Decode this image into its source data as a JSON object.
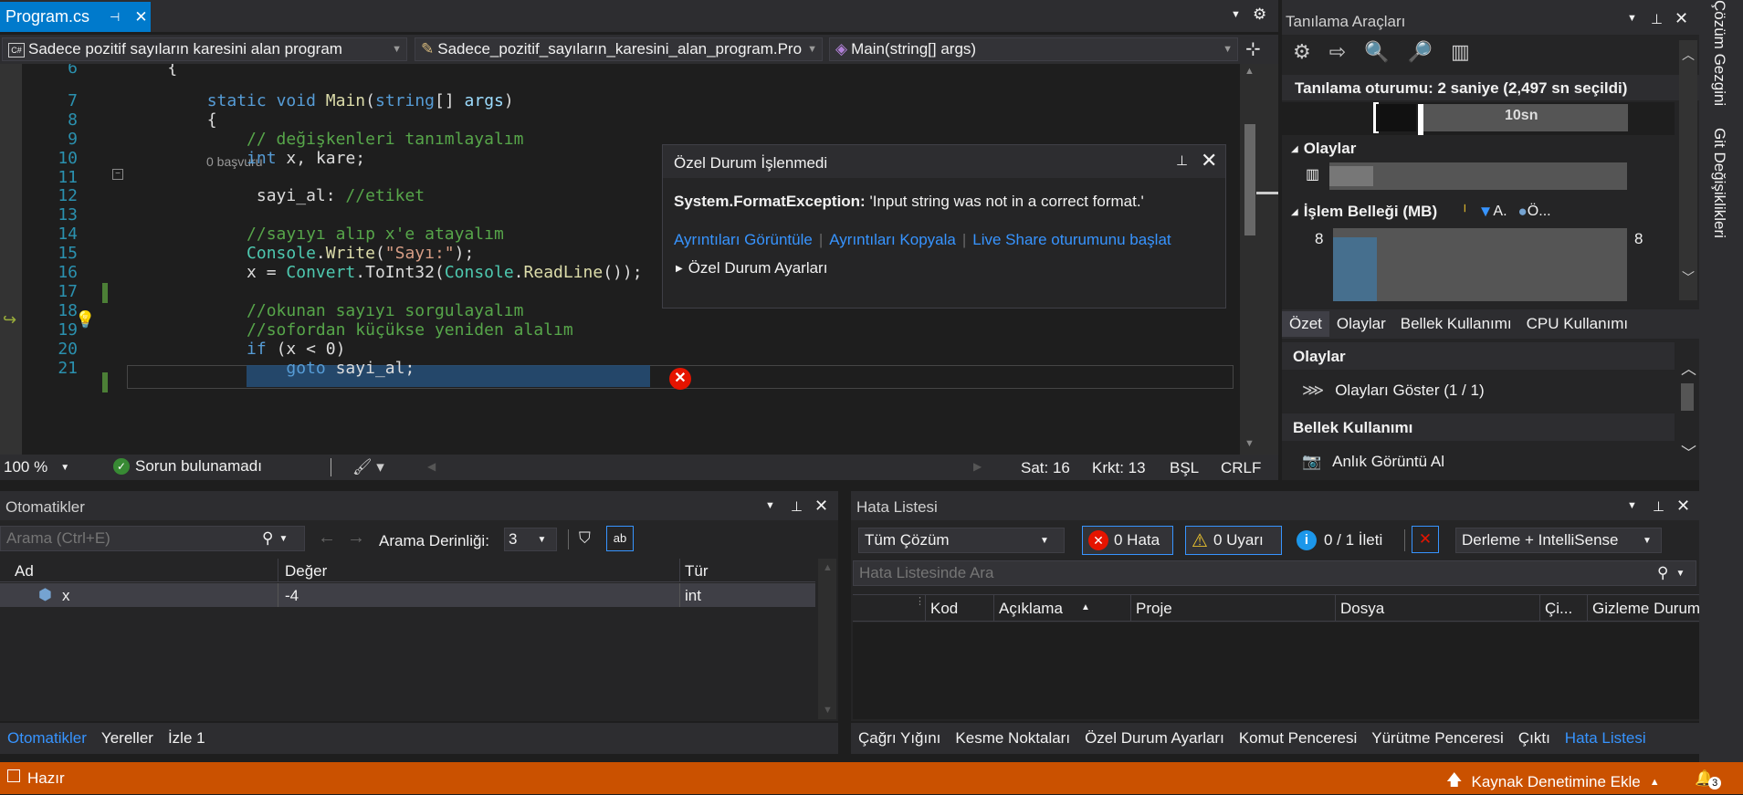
{
  "editor": {
    "tab_title": "Program.cs",
    "nav_project": "Sadece pozitif sayıların karesini alan program",
    "nav_class": "Sadece_pozitif_sayıların_karesini_alan_program.Pro",
    "nav_member": "Main(string[] args)",
    "references": "0 başvuru",
    "lines": [
      {
        "n": "6",
        "code": "    {"
      },
      {
        "n": "7",
        "code": "        static void Main(string[] args)"
      },
      {
        "n": "8",
        "code": "        {"
      },
      {
        "n": "9",
        "code": "            // değişkenleri tanımlayalım"
      },
      {
        "n": "10",
        "code": "            int x, kare;"
      },
      {
        "n": "11",
        "code": ""
      },
      {
        "n": "12",
        "code": "             sayi_al: //etiket"
      },
      {
        "n": "13",
        "code": ""
      },
      {
        "n": "14",
        "code": "            //sayıyı alıp x'e atayalım"
      },
      {
        "n": "15",
        "code": "            Console.Write(\"Sayı:\");"
      },
      {
        "n": "16",
        "code": "            x = Convert.ToInt32(Console.ReadLine());"
      },
      {
        "n": "17",
        "code": ""
      },
      {
        "n": "18",
        "code": "            //okunan sayıyı sorgulayalım"
      },
      {
        "n": "19",
        "code": "            //sofordan küçükse yeniden alalım"
      },
      {
        "n": "20",
        "code": "            if (x < 0)"
      },
      {
        "n": "21",
        "code": "                goto sayi_al;"
      }
    ],
    "zoom": "100 %",
    "issues": "Sorun bulunamadı",
    "line_pos": "Sat: 16",
    "col_pos": "Krkt: 13",
    "insert_mode": "BŞL",
    "line_ending": "CRLF"
  },
  "popup": {
    "title": "Özel Durum İşlenmedi",
    "exception_type": "System.FormatException:",
    "message": "'Input string was not in a correct format.'",
    "link1": "Ayrıntıları Görüntüle",
    "link2": "Ayrıntıları Kopyala",
    "link3": "Live Share oturumunu başlat",
    "settings": "Özel Durum Ayarları"
  },
  "diag": {
    "title": "Tanılama Araçları",
    "session": "Tanılama oturumu: 2 saniye (2,497 sn seçildi)",
    "timeline_label": "10sn",
    "events_label": "Olaylar",
    "memory_label": "İşlem Belleği (MB)",
    "legend_a": "A.",
    "legend_o": "Ö...",
    "mem_left": "8",
    "mem_right": "8",
    "tabs": [
      "Özet",
      "Olaylar",
      "Bellek Kullanımı",
      "CPU Kullanımı"
    ],
    "sec_events": "Olaylar",
    "show_events": "Olayları Göster (1 / 1)",
    "sec_memory": "Bellek Kullanımı",
    "snapshot": "Anlık Görüntü Al"
  },
  "autos": {
    "title": "Otomatikler",
    "search_placeholder": "Arama (Ctrl+E)",
    "depth_label": "Arama Derinliği:",
    "depth_value": "3",
    "col_name": "Ad",
    "col_value": "Değer",
    "col_type": "Tür",
    "row_name": "x",
    "row_value": "-4",
    "row_type": "int",
    "tabs": [
      "Otomatikler",
      "Yereller",
      "İzle 1"
    ]
  },
  "errors": {
    "title": "Hata Listesi",
    "scope": "Tüm Çözüm",
    "errors_btn": "0 Hata",
    "warnings_btn": "0 Uyarı",
    "messages_btn": "0 / 1 İleti",
    "build": "Derleme + IntelliSense",
    "search_placeholder": "Hata Listesinde Ara",
    "cols": [
      "Kod",
      "Açıklama",
      "Proje",
      "Dosya",
      "Çi...",
      "Gizleme Durum"
    ],
    "tabs": [
      "Çağrı Yığını",
      "Kesme Noktaları",
      "Özel Durum Ayarları",
      "Komut Penceresi",
      "Yürütme Penceresi",
      "Çıktı",
      "Hata Listesi"
    ]
  },
  "status": {
    "ready": "Hazır",
    "source_control": "Kaynak Denetimine Ekle",
    "badge": "3"
  },
  "side": {
    "solution": "Çözüm Gezgini",
    "git": "Git Değişiklikleri"
  },
  "colors": {
    "accent": "#007acc",
    "status_bar": "#ca5100",
    "error": "#e51400"
  }
}
